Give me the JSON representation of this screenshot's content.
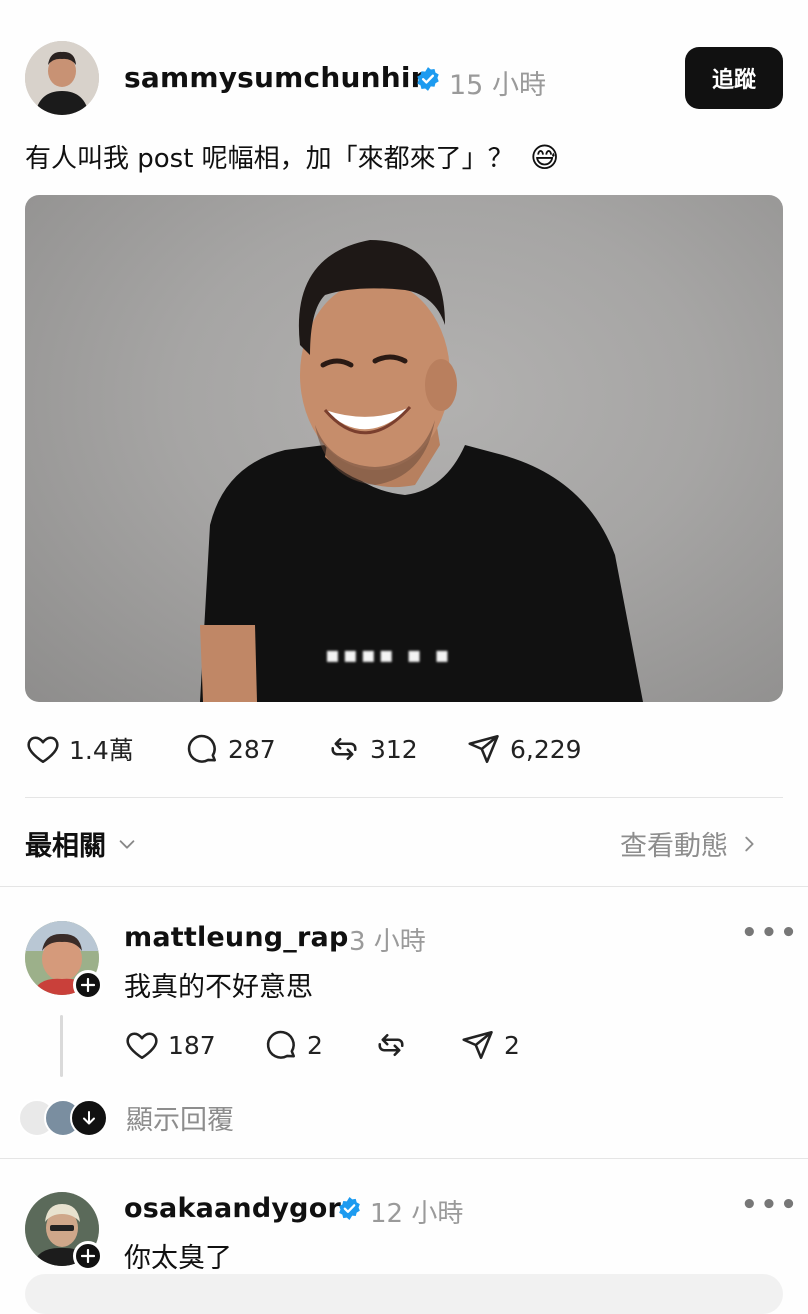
{
  "post": {
    "username": "sammysumchunhin",
    "time": "15 小時",
    "follow_label": "追蹤",
    "caption": "有人叫我 post 呢幅相，加「來都來了」？",
    "caption_emoji": "😅",
    "photo_watermark": "▪▪▪▪ ▪ ▪",
    "stats": {
      "likes": "1.4萬",
      "comments": "287",
      "reposts": "312",
      "shares": "6,229"
    }
  },
  "sort": {
    "label": "最相關",
    "activity_link": "查看動態"
  },
  "comments": [
    {
      "username": "mattleung_rap",
      "time": "3 小時",
      "text": "我真的不好意思",
      "likes": "187",
      "replies": "2",
      "shares": "2",
      "show_replies_label": "顯示回覆"
    },
    {
      "username": "osakaandygor",
      "time": "12 小時",
      "text": "你太臭了"
    }
  ],
  "icons": [
    "verified-badge-icon",
    "heart-icon",
    "comment-icon",
    "repost-icon",
    "share-icon",
    "chevron-down-icon",
    "chevron-right-icon",
    "more-icon",
    "plus-icon",
    "arrow-down-icon"
  ],
  "colors": {
    "verified": "#1d9bf0",
    "button": "#111111",
    "muted": "#9a9a9a"
  }
}
